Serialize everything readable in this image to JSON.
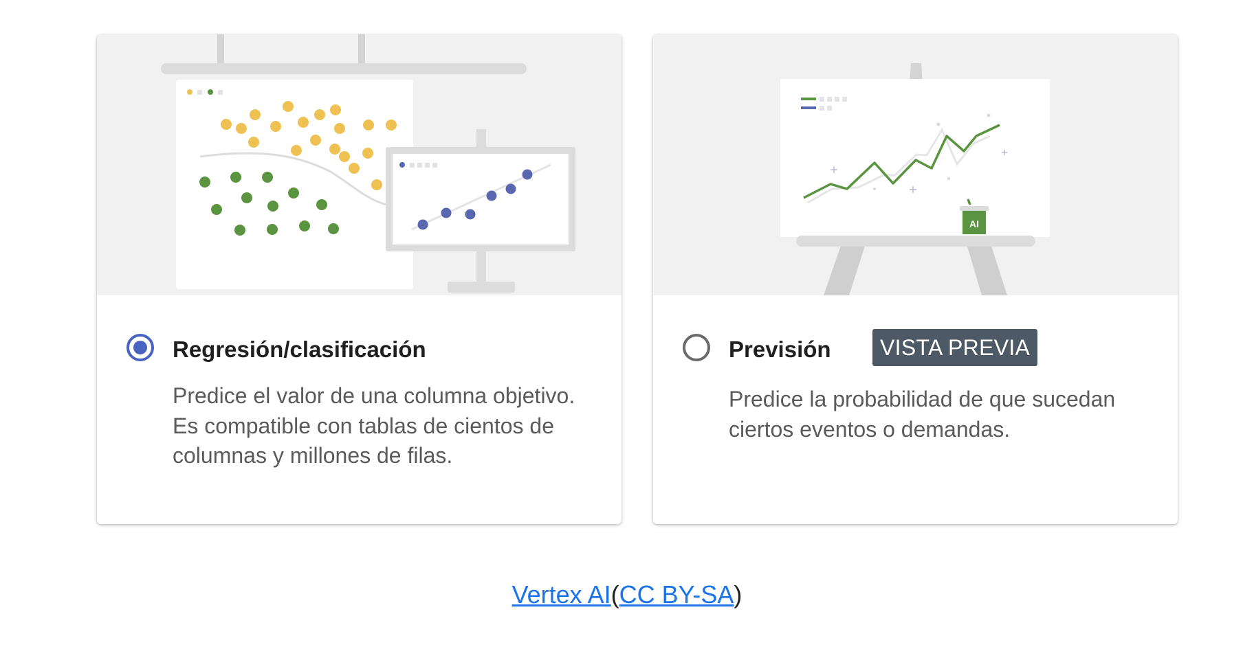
{
  "options": [
    {
      "title": "Regresión/clasificación",
      "description": "Predice el valor de una columna objetivo. Es compatible con tablas de cientos de columnas y millones de filas.",
      "selected": true
    },
    {
      "title": "Previsión",
      "badge": "VISTA PREVIA",
      "description": "Predice la probabilidad de que sucedan ciertos eventos o demandas.",
      "selected": false
    }
  ],
  "forecast_illustration": {
    "ai_label": "AI"
  },
  "caption": {
    "link1": "Vertex AI",
    "open_paren": "(",
    "link2": "CC BY-SA",
    "close_paren": ")"
  },
  "colors": {
    "accent_radio": "#4a63c0",
    "badge_bg": "#4d5a66",
    "link": "#1a73e8",
    "yellow_dot": "#eec152",
    "green_dot": "#5a9440",
    "blue_dot": "#5966b0"
  }
}
